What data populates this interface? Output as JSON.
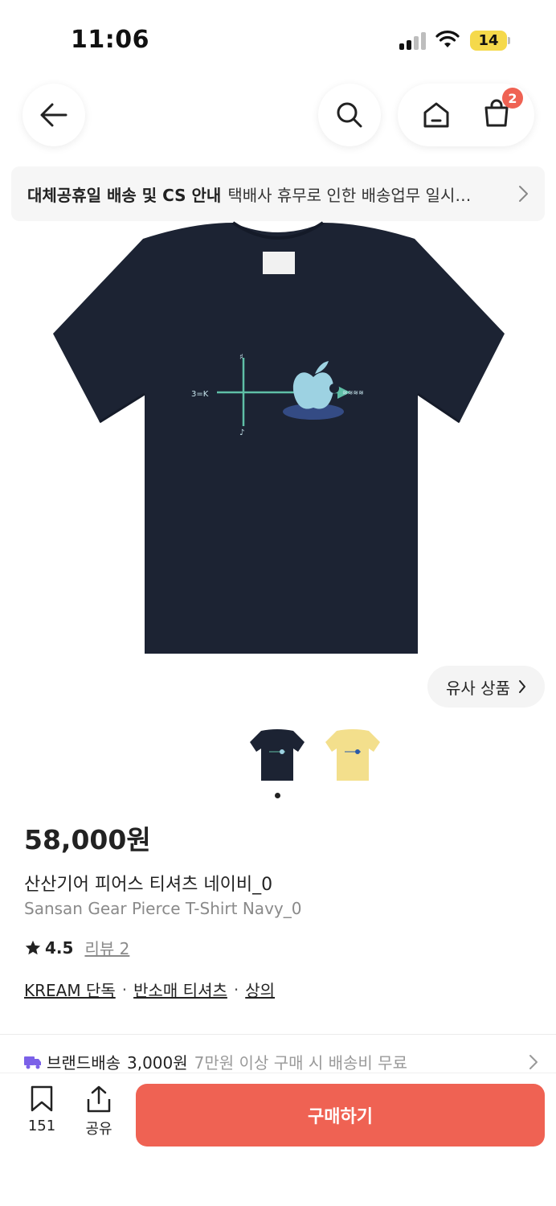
{
  "status_bar": {
    "time": "11:06",
    "battery": "14"
  },
  "nav": {
    "cart_count": "2"
  },
  "notice": {
    "title": "대체공휴일 배송 및 CS 안내",
    "text": "택배사 휴무로 인한 배송업무 일시…"
  },
  "similar_button": "유사 상품",
  "product": {
    "price": "58,000원",
    "name_ko": "산산기어 피어스 티셔츠 네이비_0",
    "name_en": "Sansan Gear Pierce T-Shirt Navy_0",
    "rating": "4.5",
    "review_label": "리뷰 2",
    "categories": [
      "KREAM 단독",
      "반소매 티셔츠",
      "상의"
    ],
    "thumbnails": [
      {
        "color": "#1c2333",
        "label": "navy"
      },
      {
        "color": "#f3df8c",
        "label": "yellow"
      }
    ],
    "main_color": "#1c2333"
  },
  "shipping": {
    "label": "브랜드배송",
    "fee": "3,000원",
    "note": "7만원 이상 구매 시 배송비 무료"
  },
  "bottom_bar": {
    "bookmark_count": "151",
    "share_label": "공유",
    "buy_label": "구매하기"
  },
  "colors": {
    "accent": "#ef6253",
    "badge": "#ef6253",
    "battery": "#f5d94b"
  }
}
